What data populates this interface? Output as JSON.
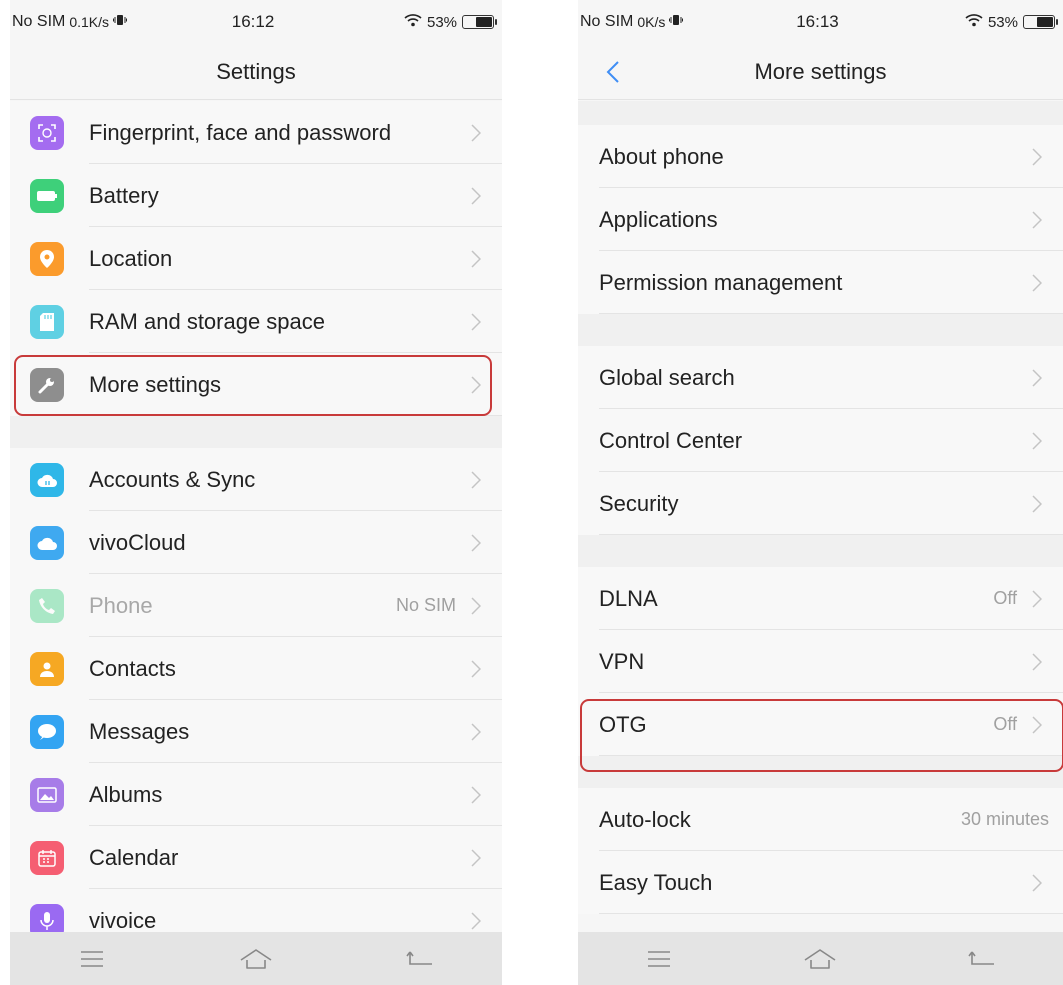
{
  "left": {
    "status": {
      "carrier": "No SIM",
      "speed": "0.1K/s",
      "time": "16:12",
      "battery_pct": "53%",
      "battery_level": 0.53
    },
    "title": "Settings",
    "group1": [
      {
        "label": "Fingerprint, face and password",
        "icon": "fingerprint-icon",
        "color": "#a46cf0"
      },
      {
        "label": "Battery",
        "icon": "battery-icon",
        "color": "#3ed07a"
      },
      {
        "label": "Location",
        "icon": "location-pin-icon",
        "color": "#fb9b2c"
      },
      {
        "label": "RAM and storage space",
        "icon": "sd-card-icon",
        "color": "#5fd0e3"
      },
      {
        "label": "More settings",
        "icon": "wrench-icon",
        "color": "#8e8e8e"
      }
    ],
    "group2": [
      {
        "label": "Accounts & Sync",
        "icon": "cloud-sync-icon",
        "color": "#2fb7e8"
      },
      {
        "label": "vivoCloud",
        "icon": "cloud-icon",
        "color": "#3fa9f0"
      },
      {
        "label": "Phone",
        "icon": "phone-icon",
        "color": "#4cd48b",
        "value": "No SIM"
      },
      {
        "label": "Contacts",
        "icon": "contact-icon",
        "color": "#f6a823"
      },
      {
        "label": "Messages",
        "icon": "message-icon",
        "color": "#33a4f2"
      },
      {
        "label": "Albums",
        "icon": "image-icon",
        "color": "#a77ce8"
      },
      {
        "label": "Calendar",
        "icon": "calendar-icon",
        "color": "#f55e72"
      },
      {
        "label": "vivoice",
        "icon": "microphone-icon",
        "color": "#9a6af2"
      }
    ]
  },
  "right": {
    "status": {
      "carrier": "No SIM",
      "speed": "0K/s",
      "time": "16:13",
      "battery_pct": "53%",
      "battery_level": 0.53
    },
    "title": "More settings",
    "groups": [
      [
        {
          "label": "About phone"
        },
        {
          "label": "Applications"
        },
        {
          "label": "Permission management"
        }
      ],
      [
        {
          "label": "Global search"
        },
        {
          "label": "Control Center"
        },
        {
          "label": "Security"
        }
      ],
      [
        {
          "label": "DLNA",
          "value": "Off"
        },
        {
          "label": "VPN"
        },
        {
          "label": "OTG",
          "value": "Off"
        }
      ],
      [
        {
          "label": "Auto-lock",
          "value": "30 minutes"
        },
        {
          "label": "Easy Touch"
        }
      ]
    ]
  },
  "colors": {
    "accent": "#3f8ef5",
    "highlight": "#c83a3a",
    "chevron": "#c4c4c4"
  }
}
